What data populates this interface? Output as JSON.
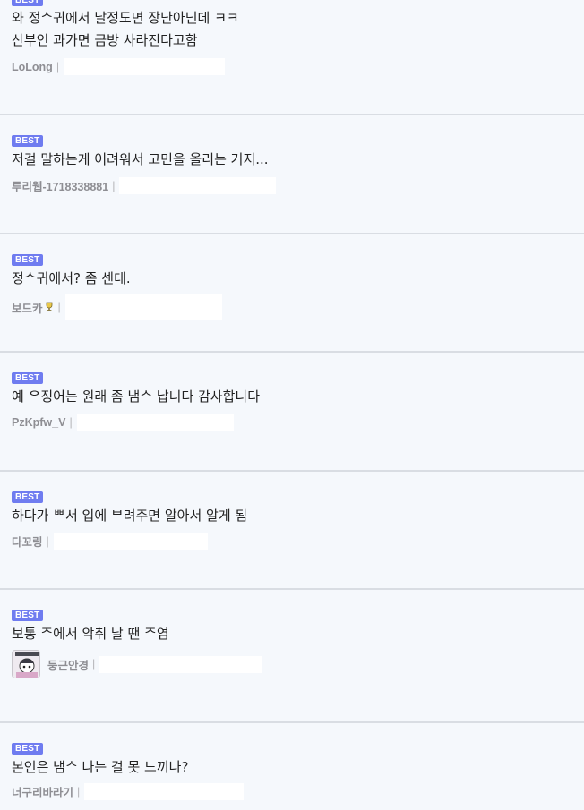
{
  "badge_label": "BEST",
  "comments": [
    {
      "lines": [
        "와 정ᄉ귀에서 날정도면 장난아닌데 ㅋㅋ",
        "산부인 과가면 금방 사라진다고함"
      ],
      "author": "LoLong",
      "separator": "|"
    },
    {
      "lines": [
        "저걸 말하는게 어려워서 고민을 올리는 거지..."
      ],
      "author": "루리웹-1718338881",
      "separator": "|"
    },
    {
      "lines": [
        "정ᄉ귀에서? 좀 센데."
      ],
      "author": "보드카",
      "separator": "|",
      "icon": "trophy-icon"
    },
    {
      "lines": [
        "예 ᄋ징어는 원래 좀 냄ᄉ 납니다 감사합니다"
      ],
      "author": "PzKpfw_V",
      "separator": "|"
    },
    {
      "lines": [
        "하다가 ᄈ서 입에 ᄇ려주면 알아서 알게 됨"
      ],
      "author": "다꼬링",
      "separator": "|"
    },
    {
      "lines": [
        "보통 ᄌ에서 악취 날 땐 ᄌ염"
      ],
      "author": "둥근안경",
      "separator": "|",
      "avatar": "avatar-image"
    },
    {
      "lines": [
        "본인은 냄ᄉ 나는 걸 못 느끼나?"
      ],
      "author": "너구리바라기",
      "separator": "|"
    }
  ]
}
